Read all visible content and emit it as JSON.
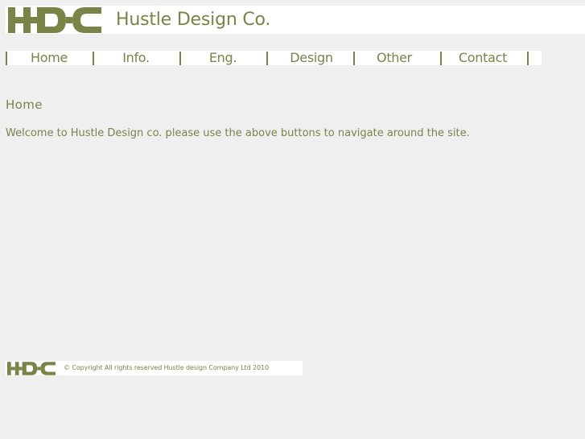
{
  "header": {
    "logo_text": "HDC",
    "site_title": "Hustle Design Co."
  },
  "nav": {
    "items": [
      {
        "label": "Home"
      },
      {
        "label": "Info."
      },
      {
        "label": "Eng."
      },
      {
        "label": "Design"
      },
      {
        "label": "Other"
      },
      {
        "label": "Contact"
      }
    ]
  },
  "main": {
    "heading": "Home",
    "welcome_text": "Welcome to Hustle Design co. please use the above buttons to navigate around the site."
  },
  "footer": {
    "logo_text": "HDC",
    "copyright": "© Copyright All rights reserved Hustle design Company Ltd 2010"
  },
  "colors": {
    "brand": "#7a8447",
    "background": "#efefef",
    "panel": "#ffffff"
  }
}
